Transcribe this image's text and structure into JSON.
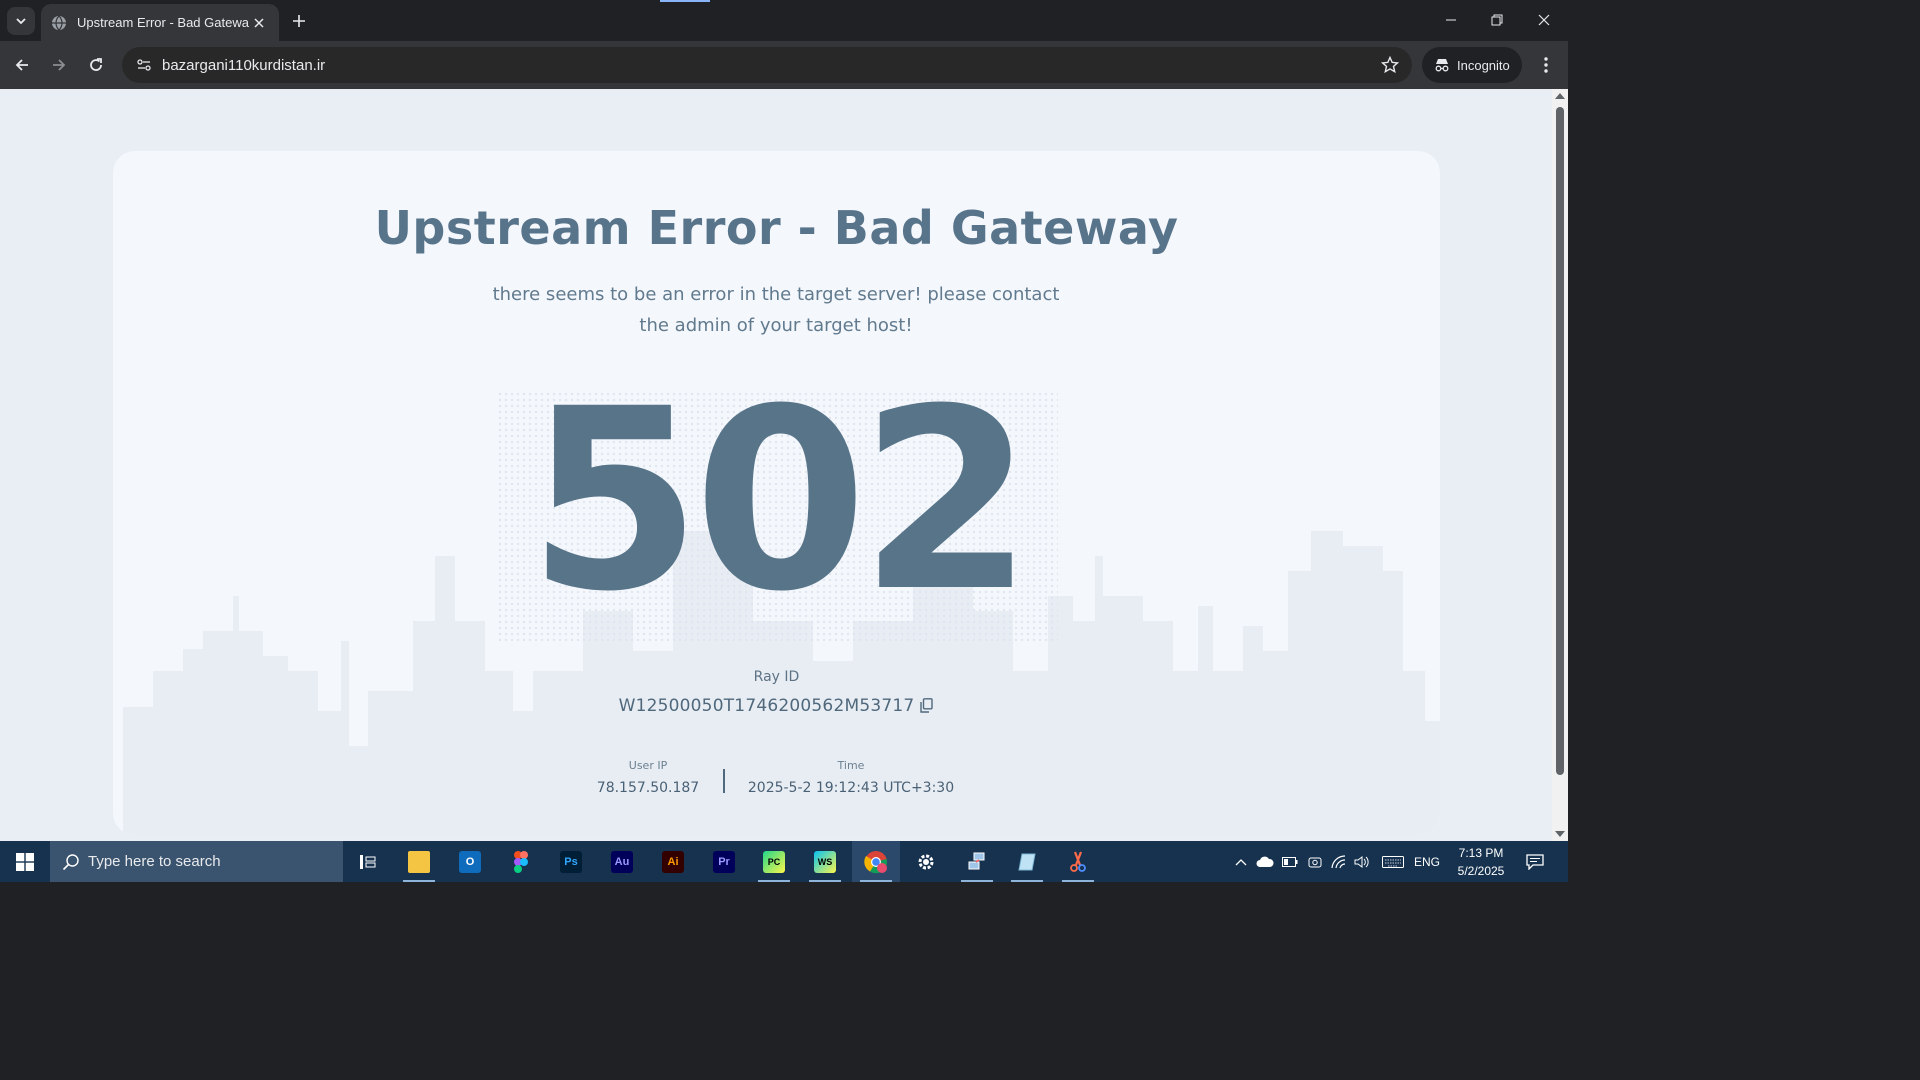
{
  "browser": {
    "tab_title": "Upstream Error - Bad Gateway",
    "url": "bazargani110kurdistan.ir",
    "profile_label": "Incognito"
  },
  "page": {
    "title": "Upstream Error - Bad Gateway",
    "subtitle_line1": "there seems to be an error in the target server! please contact",
    "subtitle_line2": "the admin of your target host!",
    "error_code": "502",
    "ray_label": "Ray ID",
    "ray_id": "W12500050T1746200562M53717",
    "user_ip_label": "User IP",
    "user_ip": "78.157.50.187",
    "time_label": "Time",
    "time": "2025-5-2 19:12:43 UTC+3:30"
  },
  "taskbar": {
    "search_placeholder": "Type here to search",
    "apps": [
      {
        "name": "task-view",
        "label": ""
      },
      {
        "name": "file-explorer",
        "label": ""
      },
      {
        "name": "outlook",
        "label": "O"
      },
      {
        "name": "figma",
        "label": ""
      },
      {
        "name": "photoshop",
        "label": "Ps"
      },
      {
        "name": "audition",
        "label": "Au"
      },
      {
        "name": "illustrator",
        "label": "Ai"
      },
      {
        "name": "premiere",
        "label": "Pr"
      },
      {
        "name": "pycharm",
        "label": "PC"
      },
      {
        "name": "webstorm",
        "label": "WS"
      },
      {
        "name": "chrome",
        "label": ""
      },
      {
        "name": "settings",
        "label": ""
      },
      {
        "name": "network-app",
        "label": ""
      },
      {
        "name": "notes-app",
        "label": ""
      },
      {
        "name": "snipping-app",
        "label": ""
      }
    ],
    "language": "ENG",
    "clock_time": "7:13 PM",
    "clock_date": "5/2/2025"
  },
  "colors": {
    "accent_text": "#58748b",
    "page_bg": "#e9eef5",
    "card_bg": "#f4f7fc",
    "taskbar_bg": "#16324f",
    "chrome_bg": "#202124"
  }
}
